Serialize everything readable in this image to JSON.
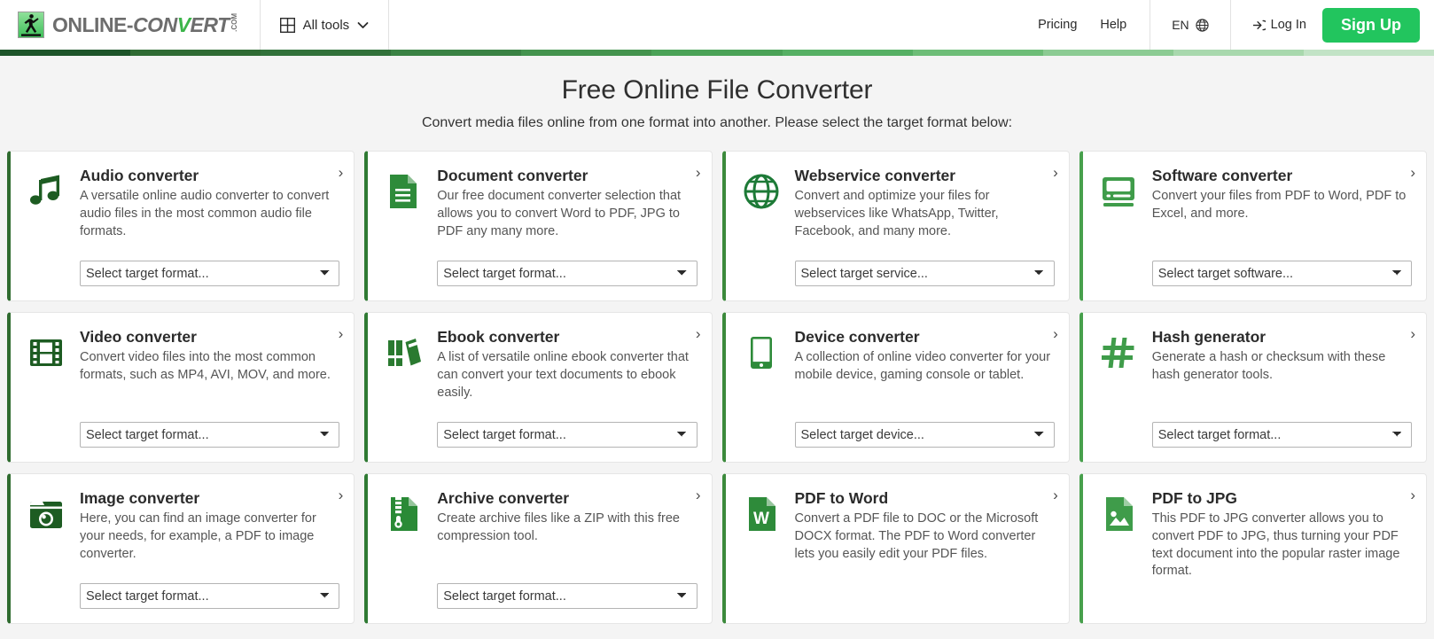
{
  "header": {
    "logo": {
      "icon": "runner-logo-icon",
      "online": "ONLINE",
      "dash": "-",
      "con": "CON",
      "v": "V",
      "ert": "ERT",
      "com": ".COM"
    },
    "all_tools": {
      "label": "All tools",
      "icon": "grid-icon",
      "chevron": "chevron-down-icon"
    },
    "links": [
      {
        "label": "Pricing",
        "name": "pricing"
      },
      {
        "label": "Help",
        "name": "help"
      }
    ],
    "language": {
      "label": "EN",
      "icon": "globe-icon"
    },
    "login": {
      "label": "Log In",
      "icon": "login-arrow-icon"
    },
    "signup": {
      "label": "Sign Up"
    }
  },
  "stripe": {
    "colors": [
      "#1d5429",
      "#2f6b33",
      "#31713a",
      "#3a8244",
      "#44934e",
      "#4aa257",
      "#56b064",
      "#6dbd77",
      "#8ccb93",
      "#a8d8ad",
      "#c2e3c6"
    ]
  },
  "main": {
    "title": "Free Online File Converter",
    "subtitle": "Convert media files online from one format into another. Please select the target format below:"
  },
  "colors": {
    "brand_green": "#22c55e",
    "accent_green": "#3cb54a",
    "card_border_dark": "#2f6b2f",
    "card_border_mid": "#3c8a3c",
    "page_bg": "#f4f4f4"
  },
  "cards": [
    {
      "name": "audio-converter",
      "icon": "music-note-icon",
      "title": "Audio converter",
      "desc": "A versatile online audio converter to convert audio files in the most common audio file formats.",
      "select_placeholder": "Select target format...",
      "has_select": true,
      "border_color": "#2f6b2f",
      "icon_color": "#1d5c22",
      "arrow": "›"
    },
    {
      "name": "document-converter",
      "icon": "document-icon",
      "title": "Document converter",
      "desc": "Our free document converter selection that allows you to convert Word to PDF, JPG to PDF any many more.",
      "select_placeholder": "Select target format...",
      "has_select": true,
      "border_color": "#2f7a33",
      "icon_color": "#2e8b3a",
      "arrow": "›"
    },
    {
      "name": "webservice-converter",
      "icon": "globe-icon",
      "title": "Webservice converter",
      "desc": "Convert and optimize your files for webservices like WhatsApp, Twitter, Facebook, and many more.",
      "select_placeholder": "Select target service...",
      "has_select": true,
      "border_color": "#3c8a3c",
      "icon_color": "#1d7a37",
      "arrow": "›"
    },
    {
      "name": "software-converter",
      "icon": "monitor-icon",
      "title": "Software converter",
      "desc": "Convert your files from PDF to Word, PDF to Excel, and more.",
      "select_placeholder": "Select target software...",
      "has_select": true,
      "border_color": "#47a04c",
      "icon_color": "#3f9c4a",
      "arrow": "›"
    },
    {
      "name": "video-converter",
      "icon": "film-strip-icon",
      "title": "Video converter",
      "desc": "Convert video files into the most common formats, such as MP4, AVI, MOV, and more.",
      "select_placeholder": "Select target format...",
      "has_select": true,
      "border_color": "#2f6b2f",
      "icon_color": "#1d5c22",
      "arrow": "›"
    },
    {
      "name": "ebook-converter",
      "icon": "books-icon",
      "title": "Ebook converter",
      "desc": "A list of versatile online ebook converter that can convert your text documents to ebook easily.",
      "select_placeholder": "Select target format...",
      "has_select": true,
      "border_color": "#2f7a33",
      "icon_color": "#2a7a30",
      "arrow": "›"
    },
    {
      "name": "device-converter",
      "icon": "tablet-icon",
      "title": "Device converter",
      "desc": "A collection of online video converter for your mobile device, gaming console or tablet.",
      "select_placeholder": "Select target device...",
      "has_select": true,
      "border_color": "#3c8a3c",
      "icon_color": "#2e8b3a",
      "arrow": "›"
    },
    {
      "name": "hash-generator",
      "icon": "hash-icon",
      "title": "Hash generator",
      "desc": "Generate a hash or checksum with these hash generator tools.",
      "select_placeholder": "Select target format...",
      "has_select": true,
      "border_color": "#47a04c",
      "icon_color": "#3f9c4a",
      "arrow": "›"
    },
    {
      "name": "image-converter",
      "icon": "camera-icon",
      "title": "Image converter",
      "desc": "Here, you can find an image converter for your needs, for example, a PDF to image converter.",
      "select_placeholder": "Select target format...",
      "has_select": true,
      "border_color": "#2f6b2f",
      "icon_color": "#1d5c22",
      "arrow": "›"
    },
    {
      "name": "archive-converter",
      "icon": "zip-file-icon",
      "title": "Archive converter",
      "desc": "Create archive files like a ZIP with this free compression tool.",
      "select_placeholder": "Select target format...",
      "has_select": true,
      "border_color": "#2f7a33",
      "icon_color": "#2a8a36",
      "arrow": "›"
    },
    {
      "name": "pdf-to-word",
      "icon": "word-file-icon",
      "title": "PDF to Word",
      "desc": "Convert a PDF file to DOC or the Microsoft DOCX format. The PDF to Word converter lets you easily edit your PDF files.",
      "select_placeholder": "",
      "has_select": false,
      "border_color": "#3c8a3c",
      "icon_color": "#2e8b3a",
      "arrow": "›"
    },
    {
      "name": "pdf-to-jpg",
      "icon": "image-file-icon",
      "title": "PDF to JPG",
      "desc": "This PDF to JPG converter allows you to convert PDF to JPG, thus turning your PDF text document into the popular raster image format.",
      "select_placeholder": "",
      "has_select": false,
      "border_color": "#47a04c",
      "icon_color": "#3f9c4a",
      "arrow": "›"
    }
  ]
}
